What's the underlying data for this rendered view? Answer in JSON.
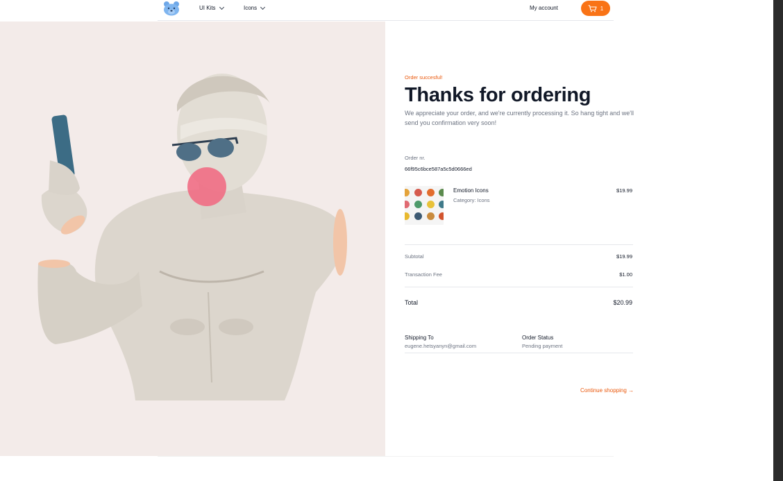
{
  "header": {
    "nav": [
      {
        "label": "UI Kits"
      },
      {
        "label": "Icons"
      }
    ],
    "account_label": "My account",
    "cart_count": "1"
  },
  "order": {
    "eyebrow": "Order succesful!",
    "title": "Thanks for ordering",
    "subtitle": "We appreciate your order, and we're currently processing it. So hang tight and we'll send you confirmation very soon!",
    "number_label": "Order nr.",
    "number": "66f95c6bce587a5c5d0666ed",
    "item": {
      "name": "Emotion Icons",
      "category": "Category: Icons",
      "price": "$19.99"
    },
    "subtotal_label": "Subtotal",
    "subtotal": "$19.99",
    "fee_label": "Transaction Fee",
    "fee": "$1.00",
    "total_label": "Total",
    "total": "$20.99",
    "shipping_label": "Shipping To",
    "shipping_email": "eugene.hetsyanyn@gmail.com",
    "status_label": "Order Status",
    "status": "Pending payment",
    "continue_label": "Continue shopping →"
  },
  "colors": {
    "accent": "#f97316",
    "hero_bg": "#f3ebe9"
  }
}
